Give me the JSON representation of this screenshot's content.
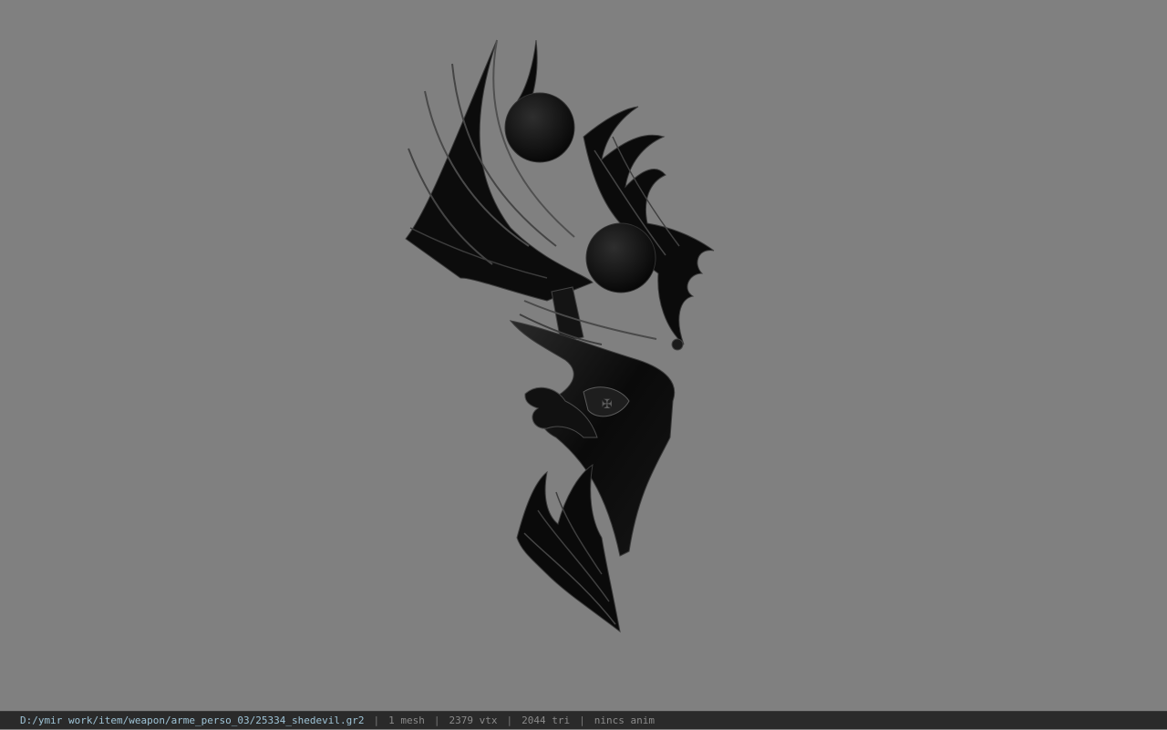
{
  "viewport": {
    "background_color": "#808080",
    "model_colors": {
      "dark": "#0b0b0b",
      "mid": "#1c1c1c",
      "highlight": "#4a4a4a"
    }
  },
  "status_bar": {
    "file_path": "D:/ymir work/item/weapon/arme_perso_03/25334_shedevil.gr2",
    "separator": "|",
    "mesh_count": "1 mesh",
    "vertex_count": "2379 vtx",
    "triangle_count": "2044 tri",
    "anim_info": "nincs anim"
  }
}
